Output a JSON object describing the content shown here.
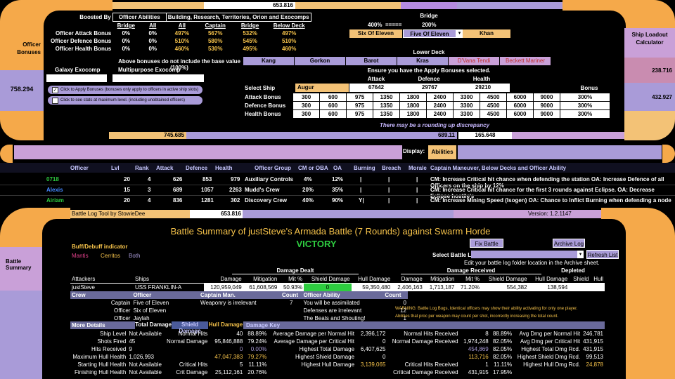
{
  "top": {
    "total_value": "653.816",
    "boosted_by": "Boosted By",
    "officer_abilities": "Officer Abilities",
    "bld_header": "Building, Research, Territories, Orion and Exocomps",
    "cols": [
      "Bridge",
      "All",
      "All",
      "Captain",
      "Bridge",
      "Below Deck"
    ],
    "rows": [
      {
        "label": "Officer Attack Bonus",
        "v": [
          "0%",
          "0%",
          "497%",
          "567%",
          "532%",
          "497%"
        ]
      },
      {
        "label": "Officer Defence Bonus",
        "v": [
          "0%",
          "0%",
          "510%",
          "580%",
          "545%",
          "510%"
        ]
      },
      {
        "label": "Officer Health Bonus",
        "v": [
          "0%",
          "0%",
          "460%",
          "530%",
          "495%",
          "460%"
        ]
      }
    ],
    "note_above": "Above bonuses do not include the base value (100%)",
    "galaxy_exocomp": "Galaxy Exocomp",
    "multipurpose_exocomp": "Multipurpose Exocomp",
    "officer_bonuses": "Officer Bonuses",
    "left_value": "758.294",
    "checkbox1": "Click to Apply Bonuses (bonuses only apply to officers in active ship slots)",
    "checkbox2": "Click to see stats at maximum level. (including unobtained officers)",
    "bottom_value_1": "745.685",
    "bridge": {
      "title": "Bridge",
      "pct1": "400%",
      "pct2": "200%",
      "arrows": "=====",
      "slot1": "Six Of Eleven",
      "slot2": "Five Of Eleven",
      "slot3": "Khan"
    },
    "lower_deck": {
      "title": "Lower Deck",
      "slots": [
        "Kang",
        "Gorkon",
        "Barot",
        "Kras",
        "D'Vana Tendi",
        "Beckett Mariner"
      ]
    },
    "ensure": "Ensure you have the Apply Bonuses selected.",
    "select_ship_label": "Select Ship",
    "ship": "Augur",
    "stat_heads": [
      "Attack",
      "Defence",
      "Health"
    ],
    "stat_vals": [
      "67642",
      "29767",
      "29210"
    ],
    "bonus_head": "Bonus",
    "bonus_rows": [
      {
        "label": "Attack Bonus",
        "v": [
          "300",
          "600",
          "975",
          "1350",
          "1800",
          "2400",
          "3300",
          "4500",
          "6000",
          "9000"
        ],
        "bonus": "300%"
      },
      {
        "label": "Defence Bonus",
        "v": [
          "300",
          "600",
          "975",
          "1350",
          "1800",
          "2400",
          "3300",
          "4500",
          "6000",
          "9000"
        ],
        "bonus": "300%"
      },
      {
        "label": "Health Bonus",
        "v": [
          "300",
          "600",
          "975",
          "1350",
          "1800",
          "2400",
          "3300",
          "4500",
          "6000",
          "9000"
        ],
        "bonus": "300%"
      }
    ],
    "rounding": "There may be a rounding up discrepancy",
    "val_689": "689.11",
    "val_165": "165.648",
    "ship_loadout": "Ship Loadout Calculator",
    "right_val1": "238.716",
    "right_val2": "432.927",
    "display_label": "Display:",
    "display_value": "Abilities"
  },
  "officers": {
    "headers": [
      "Officer",
      "Lvl",
      "Rank",
      "Attack",
      "Defence",
      "Health",
      "Officer Group",
      "CM or OBA",
      "OA",
      "Burning",
      "Breach",
      "Morale",
      "Captain Maneuver, Below Decks and Officer Ability"
    ],
    "rows": [
      {
        "name": "0718",
        "lvl": "20",
        "rank": "4",
        "atk": "626",
        "def": "853",
        "hp": "979",
        "grp": "Auxiliary Controls",
        "cm": "4%",
        "oa": "12%",
        "b1": "|",
        "b2": "|",
        "b3": "|",
        "desc": "CM: Increase Critical hit chance when defending the station OA: Increase Defence of all Officers on the ship by 12%"
      },
      {
        "name": "Alexis",
        "lvl": "15",
        "rank": "3",
        "atk": "689",
        "def": "1057",
        "hp": "2263",
        "grp": "Mudd's Crew",
        "cm": "20%",
        "oa": "35%",
        "b1": "|",
        "b2": "|",
        "b3": "|",
        "desc": "CM: Increase Critical hit chance for the first 3 rounds against Eclipse. OA: Decrease Eclipse hostile's"
      },
      {
        "name": "Airiam",
        "lvl": "20",
        "rank": "4",
        "atk": "836",
        "def": "1281",
        "hp": "302",
        "grp": "Discovery Crew",
        "cm": "40%",
        "oa": "90%",
        "b1": "Y|",
        "b2": "|",
        "b3": "|",
        "desc": "CM: Increase Mining Speed (Isogen) OA: Chance to Inflict Burning when defending a node"
      }
    ]
  },
  "battle": {
    "tool_title": "Battle Log Tool by StowieDee",
    "tool_value": "653.816",
    "version": "Version: 1.2.1147",
    "title": "Battle Summary of justSteve's Armada Battle (7 Rounds) against Swarm Horde",
    "result": "VICTORY",
    "fix_btn": "Fix Battle Log",
    "archive_btn": "Archive Log",
    "refresh_btn": "Refresh List",
    "select_log": "Select Battle Log",
    "edit_note": "Edit your battle log folder location in the Archive sheet.",
    "buff_title": "Buff/Debuff indicator",
    "buff_mantis": "Mantis",
    "buff_cerritos": "Cerritos",
    "buff_both": "Both",
    "side_label": "Battle Summary",
    "damage_dealt": "Damage Dealt",
    "damage_received": "Damage Received",
    "depleted": "Depleted",
    "head": [
      "Attackers",
      "Ships",
      "Damage",
      "Mitigation",
      "Mit %",
      "Shield Damage",
      "Hull Damage",
      "Damage",
      "Mitigation",
      "Mit %",
      "Shield Damage",
      "Hull Damage",
      "Shield",
      "Hull"
    ],
    "attacker": [
      "justSteve",
      "USS FRANKLIN-A",
      "120,959,049",
      "61,608,569",
      "50.93%",
      "0",
      "59,350,480",
      "2,406,163",
      "1,713,187",
      "71.20%",
      "554,382",
      "138,594",
      "",
      ""
    ],
    "crew_head": [
      "Crew",
      "Officer",
      "Captain Man.",
      "Count",
      "Officer Ability",
      "Count"
    ],
    "crew": [
      {
        "role": "Captain",
        "officer": "Five of Eleven",
        "cm": "Weaponry is irrelevant",
        "count": "7",
        "oa": "You will be assimilated",
        "count2": "0"
      },
      {
        "role": "Officer",
        "officer": "Six of Eleven",
        "cm": "",
        "count": "",
        "oa": "Defenses are irrelevant",
        "count2": "12"
      },
      {
        "role": "Officer",
        "officer": "Jaylah",
        "cm": "",
        "count": "",
        "oa": "The Beats and Shouting!",
        "count2": "1"
      }
    ],
    "warning1": "WARNING: Battle Log Bugs, Identical officers may show their ability activating for only one player.",
    "warning2": "Abilities that proc per weapon may count per shot, incorrectly increasing the total count.",
    "more_details": "More Details",
    "dmg_key": [
      "Total Damage",
      "Shield Damage",
      "Hull Damage",
      "Damage Key"
    ],
    "stats": [
      [
        "Ship Level",
        "Not Available",
        "Normal Hits",
        "40",
        "88.89%",
        "Average Damage per Normal Hit",
        "2,396,172",
        "Normal Hits Received",
        "8",
        "88.89%",
        "Avg Dmg per Normal Hit",
        "246,781"
      ],
      [
        "Shots Fired",
        "45",
        "Normal Damage",
        "95,846,888",
        "79.24%",
        "Average Damage per Critical Hit",
        "0",
        "Normal Damage Received",
        "1,974,248",
        "82.05%",
        "Avg Dmg per Critical Hit",
        "431,915"
      ],
      [
        "Hits Received",
        "9",
        "",
        "0",
        "0.00%",
        "Highest Total Damage",
        "6,407,625",
        "",
        "454,869",
        "82.05%",
        "Highest Total Dmg Rcd.",
        "431,915"
      ],
      [
        "Maximum Hull Health",
        "1,026,993",
        "",
        "47,047,383",
        "79.27%",
        "Highest Shield Damage",
        "0",
        "",
        "113,716",
        "82.05%",
        "Highest Shield Dmg Rcd.",
        "99,513"
      ],
      [
        "Starting Hull Health",
        "Not Available",
        "Critical Hits",
        "5",
        "11.11%",
        "Highest Hull Damage",
        "3,139,065",
        "Critical Hits Received",
        "1",
        "11.11%",
        "Highest Hull Dmg Rcd.",
        "24,878"
      ],
      [
        "Finishing Hull Health",
        "Not Available",
        "Crit Damage",
        "25,112,161",
        "20.76%",
        "",
        "",
        "Critical Damage Received",
        "431,915",
        "17.95%",
        "",
        ""
      ]
    ]
  }
}
